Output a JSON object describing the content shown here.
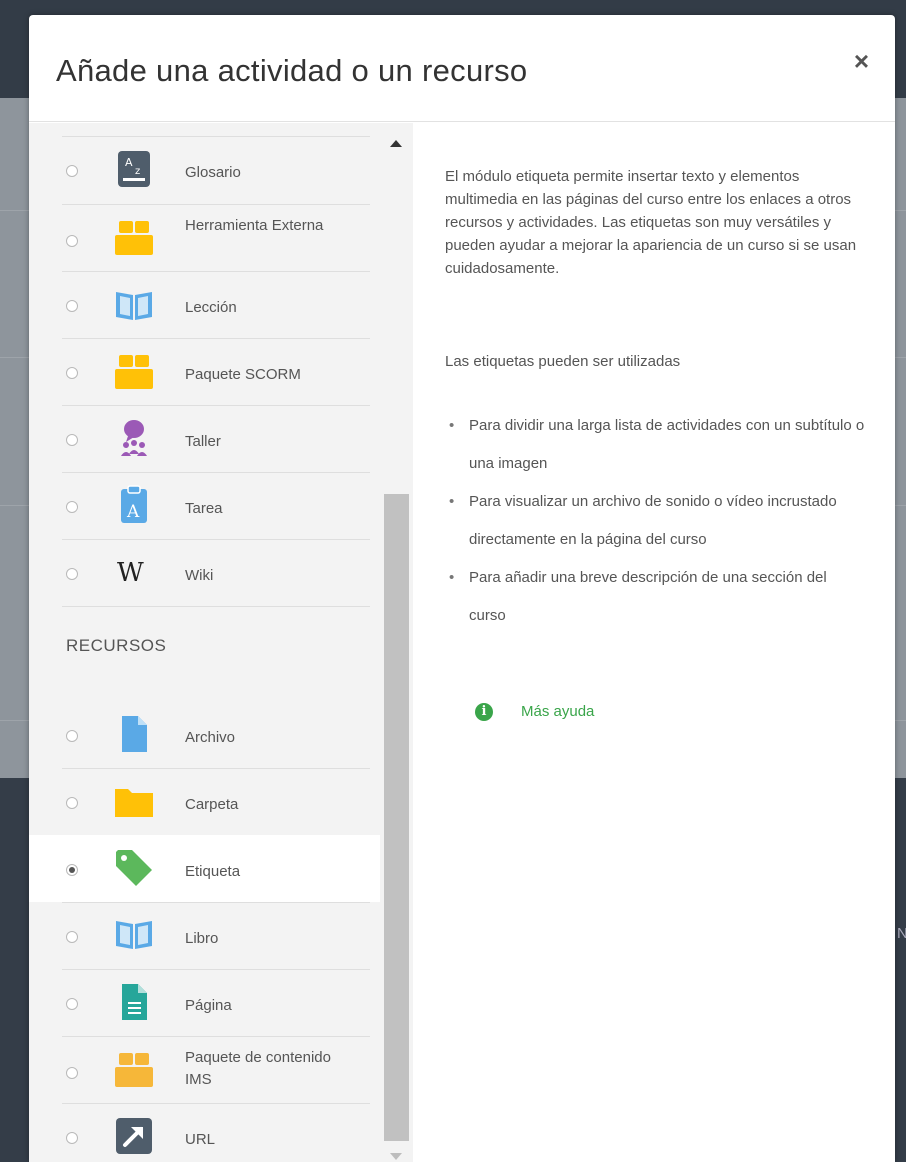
{
  "modal": {
    "title": "Añade una actividad o un recurso",
    "close_label": "×"
  },
  "activities": [
    {
      "label": "Glosario",
      "icon": "glossary-icon"
    },
    {
      "label": "Herramienta Externa",
      "icon": "puzzle-icon"
    },
    {
      "label": "Lección",
      "icon": "book-icon"
    },
    {
      "label": "Paquete SCORM",
      "icon": "package-icon"
    },
    {
      "label": "Taller",
      "icon": "workshop-icon"
    },
    {
      "label": "Tarea",
      "icon": "assignment-icon"
    },
    {
      "label": "Wiki",
      "icon": "wiki-icon"
    }
  ],
  "resources_title": "RECURSOS",
  "resources": [
    {
      "label": "Archivo",
      "icon": "file-icon"
    },
    {
      "label": "Carpeta",
      "icon": "folder-icon"
    },
    {
      "label": "Etiqueta",
      "icon": "tag-icon",
      "selected": true
    },
    {
      "label": "Libro",
      "icon": "book-icon"
    },
    {
      "label": "Página",
      "icon": "page-icon"
    },
    {
      "label": "Paquete de contenido IMS",
      "icon": "package-icon"
    },
    {
      "label": "URL",
      "icon": "url-icon"
    }
  ],
  "help": {
    "paragraph1": "El módulo etiqueta permite insertar texto y elementos multimedia en las páginas del curso entre los enlaces a otros recursos y actividades. Las etiquetas son muy versátiles y pueden ayudar a mejorar la apariencia de un curso si se usan cuidadosamente.",
    "paragraph2": "Las etiquetas pueden ser utilizadas",
    "bullets": [
      "Para dividir una larga lista de actividades con un subtítulo o una imagen",
      "Para visualizar un archivo de sonido o vídeo incrustado directamente en la página del curso",
      "Para añadir una breve descripción de una sección del curso"
    ],
    "more_help": "Más ayuda"
  },
  "colors": {
    "accent_green": "#3aa54a",
    "icon_yellow": "#ffc107",
    "icon_blue": "#5aa9e6",
    "icon_purple": "#9b59b6",
    "icon_teal": "#26a69a",
    "icon_slate": "#4f5d6b"
  }
}
